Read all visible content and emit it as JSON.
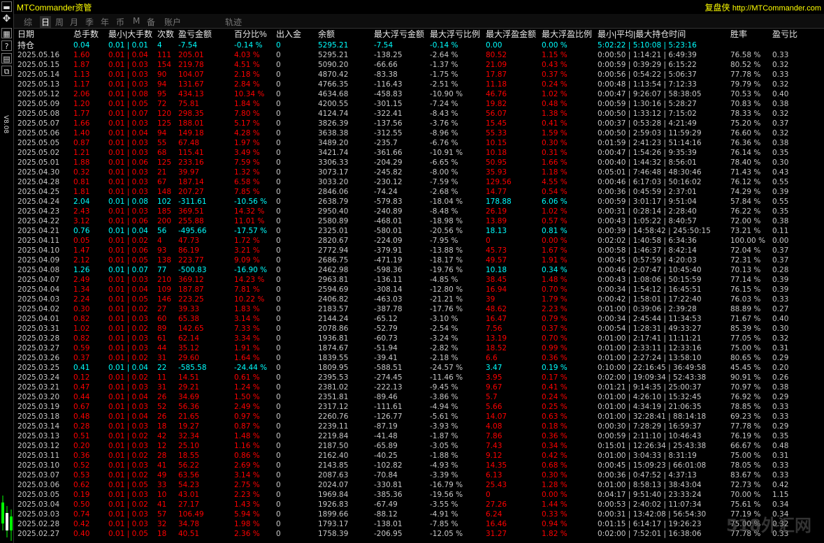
{
  "app": {
    "title": "MTCommander资管",
    "brand_cn": "复盘侠",
    "brand_url": "http://MTCommander.com"
  },
  "toolbar": {
    "version": "V8.08"
  },
  "tabs": [
    {
      "label": "综",
      "active": false
    },
    {
      "label": "日",
      "active": true
    },
    {
      "label": "周",
      "active": false
    },
    {
      "label": "月",
      "active": false
    },
    {
      "label": "季",
      "active": false
    },
    {
      "label": "年",
      "active": false
    },
    {
      "label": "币",
      "active": false
    },
    {
      "label": "M",
      "active": false
    },
    {
      "label": "备",
      "active": false
    },
    {
      "label": "账户",
      "active": false
    },
    {
      "label": "轨迹",
      "active": false
    }
  ],
  "columns": [
    "日期",
    "总手数",
    "最小|大手数",
    "次数",
    "盈亏金额",
    "百分比%",
    "出入金",
    "余额",
    "最大浮亏金额",
    "最大浮亏比例",
    "最大浮盈金额",
    "最大浮盈比例",
    "最小|平均|最大持仓时间",
    "胜率",
    "盈亏比"
  ],
  "holding": [
    "持仓",
    "0.04",
    "0.01 | 0.01",
    "4",
    "-7.54",
    "-0.14 %",
    "0",
    "5295.21",
    "-7.54",
    "-0.14 %",
    "0.00",
    "0.00 %",
    "5:02:22 | 5:10:08 | 5:23:16",
    "",
    ""
  ],
  "rows": [
    {
      "c": [
        "2025.05.16",
        "1.60",
        "0.01 | 0.04",
        "111",
        "205.01",
        "4.03 %",
        "0",
        "5295.21",
        "-138.25",
        "-2.64 %",
        "80.52",
        "1.15 %",
        "0:00:50 | 1:14:21 | 6:49:39",
        "76.58 %",
        "0.33"
      ],
      "p": true
    },
    {
      "c": [
        "2025.05.15",
        "1.87",
        "0.01 | 0.03",
        "154",
        "219.78",
        "4.51 %",
        "0",
        "5090.20",
        "-66.66",
        "-1.37 %",
        "21.09",
        "0.43 %",
        "0:00:59 | 0:39:29 | 6:15:22",
        "80.52 %",
        "0.32"
      ],
      "p": true
    },
    {
      "c": [
        "2025.05.14",
        "1.13",
        "0.01 | 0.03",
        "90",
        "104.07",
        "2.18 %",
        "0",
        "4870.42",
        "-83.38",
        "-1.75 %",
        "17.87",
        "0.37 %",
        "0:00:56 | 0:54:22 | 5:06:37",
        "77.78 %",
        "0.33"
      ],
      "p": true
    },
    {
      "c": [
        "2025.05.13",
        "1.17",
        "0.01 | 0.03",
        "94",
        "131.67",
        "2.84 %",
        "0",
        "4766.35",
        "-116.43",
        "-2.51 %",
        "11.18",
        "0.24 %",
        "0:00:48 | 1:13:54 | 7:12:33",
        "79.79 %",
        "0.32"
      ],
      "p": true
    },
    {
      "c": [
        "2025.05.12",
        "2.06",
        "0.01 | 0.08",
        "95",
        "434.13",
        "10.34 %",
        "0",
        "4634.68",
        "-458.83",
        "-10.90 %",
        "46.76",
        "1.02 %",
        "0:00:47 | 9:26:07 | 58:38:05",
        "70.53 %",
        "0.40"
      ],
      "p": true
    },
    {
      "c": [
        "2025.05.09",
        "1.20",
        "0.01 | 0.05",
        "72",
        "75.81",
        "1.84 %",
        "0",
        "4200.55",
        "-301.15",
        "-7.24 %",
        "19.82",
        "0.48 %",
        "0:00:59 | 1:30:16 | 5:28:27",
        "70.83 %",
        "0.38"
      ],
      "p": true
    },
    {
      "c": [
        "2025.05.08",
        "1.77",
        "0.01 | 0.07",
        "120",
        "298.35",
        "7.80 %",
        "0",
        "4124.74",
        "-322.41",
        "-8.43 %",
        "56.07",
        "1.38 %",
        "0:00:50 | 1:33:12 | 7:15:02",
        "78.33 %",
        "0.32"
      ],
      "p": true
    },
    {
      "c": [
        "2025.05.07",
        "1.66",
        "0.01 | 0.03",
        "125",
        "188.01",
        "5.17 %",
        "0",
        "3826.39",
        "-137.56",
        "-3.76 %",
        "15.45",
        "0.41 %",
        "0:00:37 | 0:53:28 | 4:21:49",
        "75.20 %",
        "0.37"
      ],
      "p": true
    },
    {
      "c": [
        "2025.05.06",
        "1.40",
        "0.01 | 0.04",
        "94",
        "149.18",
        "4.28 %",
        "0",
        "3638.38",
        "-312.55",
        "-8.96 %",
        "55.33",
        "1.59 %",
        "0:00:50 | 2:59:03 | 11:59:29",
        "76.60 %",
        "0.32"
      ],
      "p": true
    },
    {
      "c": [
        "2025.05.05",
        "0.87",
        "0.01 | 0.03",
        "55",
        "67.48",
        "1.97 %",
        "0",
        "3489.20",
        "-235.7",
        "-6.76 %",
        "10.15",
        "0.30 %",
        "0:01:59 | 2:41:23 | 51:14:16",
        "76.36 %",
        "0.38"
      ],
      "p": true
    },
    {
      "c": [
        "2025.05.02",
        "1.21",
        "0.01 | 0.03",
        "68",
        "115.41",
        "3.49 %",
        "0",
        "3421.74",
        "-361.66",
        "-10.91 %",
        "10.18",
        "0.31 %",
        "0:00:47 | 1:54:26 | 9:35:39",
        "76.14 %",
        "0.35"
      ],
      "p": true
    },
    {
      "c": [
        "2025.05.01",
        "1.88",
        "0.01 | 0.06",
        "125",
        "233.16",
        "7.59 %",
        "0",
        "3306.33",
        "-204.29",
        "-6.65 %",
        "50.95",
        "1.66 %",
        "0:00:40 | 1:44:32 | 8:56:01",
        "78.40 %",
        "0.30"
      ],
      "p": true
    },
    {
      "c": [
        "2025.04.30",
        "0.32",
        "0.01 | 0.03",
        "21",
        "39.97",
        "1.32 %",
        "0",
        "3073.17",
        "-245.82",
        "-8.00 %",
        "35.93",
        "1.18 %",
        "0:05:01 | 7:46:48 | 48:30:46",
        "71.43 %",
        "0.43"
      ],
      "p": true
    },
    {
      "c": [
        "2025.04.28",
        "0.81",
        "0.01 | 0.03",
        "67",
        "187.14",
        "6.58 %",
        "0",
        "3033.20",
        "-230.12",
        "-7.59 %",
        "129.56",
        "4.55 %",
        "0:00:46 | 6:17:03 | 50:16:02",
        "76.12 %",
        "0.55"
      ],
      "p": true
    },
    {
      "c": [
        "2025.04.25",
        "1.81",
        "0.01 | 0.03",
        "148",
        "207.27",
        "7.85 %",
        "0",
        "2846.06",
        "-74.24",
        "-2.68 %",
        "14.77",
        "0.54 %",
        "0:00:36 | 0:45:59 | 2:37:01",
        "74.29 %",
        "0.39"
      ],
      "p": true
    },
    {
      "c": [
        "2025.04.24",
        "2.04",
        "0.01 | 0.08",
        "102",
        "-311.61",
        "-10.56 %",
        "0",
        "2638.79",
        "-579.83",
        "-18.04 %",
        "178.88",
        "6.06 %",
        "0:00:59 | 3:01:17 | 9:51:04",
        "57.84 %",
        "0.55"
      ],
      "p": false
    },
    {
      "c": [
        "2025.04.23",
        "2.43",
        "0.01 | 0.03",
        "185",
        "369.51",
        "14.32 %",
        "0",
        "2950.40",
        "-240.89",
        "-8.48 %",
        "26.19",
        "1.02 %",
        "0:00:31 | 0:28:14 | 2:28:40",
        "76.22 %",
        "0.35"
      ],
      "p": true
    },
    {
      "c": [
        "2025.04.22",
        "3.12",
        "0.01 | 0.06",
        "200",
        "255.88",
        "11.01 %",
        "0",
        "2580.89",
        "-468.01",
        "-18.98 %",
        "13.89",
        "0.57 %",
        "0:00:43 | 1:05:22 | 8:40:57",
        "72.00 %",
        "0.38"
      ],
      "p": true
    },
    {
      "c": [
        "2025.04.21",
        "0.76",
        "0.01 | 0.04",
        "56",
        "-495.66",
        "-17.57 %",
        "0",
        "2325.01",
        "-580.01",
        "-20.56 %",
        "18.13",
        "0.81 %",
        "0:00:39 | 14:58:42 | 245:50:15",
        "73.21 %",
        "0.11"
      ],
      "p": false
    },
    {
      "c": [
        "2025.04.11",
        "0.05",
        "0.01 | 0.02",
        "4",
        "47.73",
        "1.72 %",
        "0",
        "2820.67",
        "-224.09",
        "-7.95 %",
        "0",
        "0.00 %",
        "0:02:02 | 1:40:58 | 6:34:36",
        "100.00 %",
        "0.00"
      ],
      "p": true
    },
    {
      "c": [
        "2025.04.10",
        "1.47",
        "0.01 | 0.06",
        "93",
        "86.19",
        "3.21 %",
        "0",
        "2772.94",
        "-379.91",
        "-13.88 %",
        "45.73",
        "1.67 %",
        "0:00:58 | 1:46:37 | 8:42:14",
        "72.04 %",
        "0.37"
      ],
      "p": true
    },
    {
      "c": [
        "2025.04.09",
        "2.12",
        "0.01 | 0.05",
        "138",
        "223.77",
        "9.09 %",
        "0",
        "2686.75",
        "-471.19",
        "-18.17 %",
        "49.57",
        "1.91 %",
        "0:00:45 | 0:57:59 | 4:20:03",
        "72.31 %",
        "0.37"
      ],
      "p": true
    },
    {
      "c": [
        "2025.04.08",
        "1.26",
        "0.01 | 0.07",
        "77",
        "-500.83",
        "-16.90 %",
        "0",
        "2462.98",
        "-598.36",
        "-19.76 %",
        "10.18",
        "0.34 %",
        "0:00:46 | 2:07:47 | 10:45:40",
        "70.13 %",
        "0.28"
      ],
      "p": false
    },
    {
      "c": [
        "2025.04.07",
        "2.49",
        "0.01 | 0.03",
        "210",
        "369.12",
        "14.23 %",
        "0",
        "2963.81",
        "-136.11",
        "-4.85 %",
        "38.45",
        "1.48 %",
        "0:00:43 | 1:08:06 | 50:15:59",
        "77.14 %",
        "0.39"
      ],
      "p": true
    },
    {
      "c": [
        "2025.04.04",
        "1.34",
        "0.01 | 0.04",
        "109",
        "187.87",
        "7.81 %",
        "0",
        "2594.69",
        "-308.14",
        "-12.80 %",
        "16.94",
        "0.70 %",
        "0:00:34 | 1:54:12 | 16:45:51",
        "76.15 %",
        "0.39"
      ],
      "p": true
    },
    {
      "c": [
        "2025.04.03",
        "2.24",
        "0.01 | 0.05",
        "146",
        "223.25",
        "10.22 %",
        "0",
        "2406.82",
        "-463.03",
        "-21.21 %",
        "39",
        "1.79 %",
        "0:00:42 | 1:58:01 | 17:22:40",
        "76.03 %",
        "0.33"
      ],
      "p": true
    },
    {
      "c": [
        "2025.04.02",
        "0.30",
        "0.01 | 0.02",
        "27",
        "39.33",
        "1.83 %",
        "0",
        "2183.57",
        "-387.78",
        "-17.76 %",
        "48.62",
        "2.23 %",
        "0:01:00 | 0:39:06 | 2:39:28",
        "88.89 %",
        "0.27"
      ],
      "p": true
    },
    {
      "c": [
        "2025.04.01",
        "0.82",
        "0.01 | 0.03",
        "60",
        "65.38",
        "3.14 %",
        "0",
        "2144.24",
        "-65.12",
        "-3.10 %",
        "16.47",
        "0.79 %",
        "0:00:34 | 2:45:44 | 11:34:53",
        "71.67 %",
        "0.40"
      ],
      "p": true
    },
    {
      "c": [
        "2025.03.31",
        "1.02",
        "0.01 | 0.02",
        "89",
        "142.65",
        "7.33 %",
        "0",
        "2078.86",
        "-52.79",
        "-2.54 %",
        "7.56",
        "0.37 %",
        "0:00:54 | 1:28:31 | 49:33:27",
        "85.39 %",
        "0.30"
      ],
      "p": true
    },
    {
      "c": [
        "2025.03.28",
        "0.82",
        "0.01 | 0.03",
        "61",
        "62.14",
        "3.34 %",
        "0",
        "1936.81",
        "-60.73",
        "-3.24 %",
        "13.19",
        "0.70 %",
        "0:01:00 | 2:17:41 | 11:11:21",
        "77.05 %",
        "0.32"
      ],
      "p": true
    },
    {
      "c": [
        "2025.03.27",
        "0.59",
        "0.01 | 0.03",
        "44",
        "35.12",
        "1.91 %",
        "0",
        "1874.67",
        "-51.94",
        "-2.82 %",
        "18.52",
        "0.99 %",
        "0:01:00 | 2:33:11 | 12:33:16",
        "75.00 %",
        "0.31"
      ],
      "p": true
    },
    {
      "c": [
        "2025.03.26",
        "0.37",
        "0.01 | 0.02",
        "31",
        "29.60",
        "1.64 %",
        "0",
        "1839.55",
        "-39.41",
        "-2.18 %",
        "6.6",
        "0.36 %",
        "0:01:00 | 2:27:24 | 13:58:10",
        "80.65 %",
        "0.29"
      ],
      "p": true
    },
    {
      "c": [
        "2025.03.25",
        "0.41",
        "0.01 | 0.04",
        "22",
        "-585.58",
        "-24.44 %",
        "0",
        "1809.95",
        "-588.51",
        "-24.57 %",
        "3.47",
        "0.19 %",
        "0:10:00 | 22:16:45 | 36:49:58",
        "45.45 %",
        "0.20"
      ],
      "p": false
    },
    {
      "c": [
        "2025.03.24",
        "0.12",
        "0.01 | 0.02",
        "11",
        "14.51",
        "0.61 %",
        "0",
        "2395.53",
        "-274.45",
        "-11.46 %",
        "3.95",
        "0.17 %",
        "0:02:00 | 19:09:34 | 52:43:38",
        "90.91 %",
        "0.26"
      ],
      "p": true
    },
    {
      "c": [
        "2025.03.21",
        "0.47",
        "0.01 | 0.03",
        "31",
        "29.21",
        "1.24 %",
        "0",
        "2381.02",
        "-222.13",
        "-9.45 %",
        "9.67",
        "0.41 %",
        "0:01:21 | 9:14:35 | 25:00:37",
        "70.97 %",
        "0.38"
      ],
      "p": true
    },
    {
      "c": [
        "2025.03.20",
        "0.44",
        "0.01 | 0.04",
        "26",
        "34.69",
        "1.50 %",
        "0",
        "2351.81",
        "-89.46",
        "-3.86 %",
        "5.7",
        "0.24 %",
        "0:01:00 | 4:26:10 | 15:32:45",
        "76.92 %",
        "0.29"
      ],
      "p": true
    },
    {
      "c": [
        "2025.03.19",
        "0.67",
        "0.01 | 0.03",
        "52",
        "56.36",
        "2.49 %",
        "0",
        "2317.12",
        "-111.61",
        "-4.94 %",
        "5.66",
        "0.25 %",
        "0:01:00 | 4:34:19 | 21:06:35",
        "78.85 %",
        "0.33"
      ],
      "p": true
    },
    {
      "c": [
        "2025.03.18",
        "0.48",
        "0.01 | 0.04",
        "26",
        "21.65",
        "0.97 %",
        "0",
        "2260.76",
        "-126.77",
        "-5.61 %",
        "14.07",
        "0.63 %",
        "0:01:00 | 32:28:41 | 88:14:18",
        "69.23 %",
        "0.33"
      ],
      "p": true
    },
    {
      "c": [
        "2025.03.14",
        "0.28",
        "0.01 | 0.03",
        "18",
        "19.27",
        "0.87 %",
        "0",
        "2239.11",
        "-87.19",
        "-3.93 %",
        "4.08",
        "0.18 %",
        "0:00:30 | 7:28:29 | 16:59:37",
        "77.78 %",
        "0.29"
      ],
      "p": true
    },
    {
      "c": [
        "2025.03.13",
        "0.51",
        "0.01 | 0.02",
        "42",
        "32.34",
        "1.48 %",
        "0",
        "2219.84",
        "-41.48",
        "-1.87 %",
        "7.86",
        "0.36 %",
        "0:00:59 | 2:11:10 | 10:46:43",
        "76.19 %",
        "0.35"
      ],
      "p": true
    },
    {
      "c": [
        "2025.03.12",
        "0.20",
        "0.01 | 0.03",
        "12",
        "25.10",
        "1.16 %",
        "0",
        "2187.50",
        "-65.89",
        "-3.05 %",
        "7.43",
        "0.34 %",
        "0:15:01 | 12:26:34 | 25:43:38",
        "66.67 %",
        "0.48"
      ],
      "p": true
    },
    {
      "c": [
        "2025.03.11",
        "0.36",
        "0.01 | 0.02",
        "28",
        "18.55",
        "0.86 %",
        "0",
        "2162.40",
        "-40.25",
        "-1.88 %",
        "9.12",
        "0.42 %",
        "0:01:00 | 3:04:33 | 8:31:19",
        "75.00 %",
        "0.31"
      ],
      "p": true
    },
    {
      "c": [
        "2025.03.10",
        "0.52",
        "0.01 | 0.03",
        "41",
        "56.22",
        "2.69 %",
        "0",
        "2143.85",
        "-102.82",
        "-4.93 %",
        "14.35",
        "0.68 %",
        "0:00:45 | 15:09:23 | 66:01:08",
        "78.05 %",
        "0.33"
      ],
      "p": true
    },
    {
      "c": [
        "2025.03.07",
        "0.53",
        "0.01 | 0.02",
        "49",
        "63.56",
        "3.14 %",
        "0",
        "2087.63",
        "-70.84",
        "-3.39 %",
        "6.13",
        "0.30 %",
        "0:00:36 | 0:47:52 | 4:37:13",
        "83.67 %",
        "0.33"
      ],
      "p": true
    },
    {
      "c": [
        "2025.03.06",
        "0.62",
        "0.01 | 0.05",
        "33",
        "54.23",
        "2.75 %",
        "0",
        "2024.07",
        "-330.81",
        "-16.79 %",
        "25.43",
        "1.28 %",
        "0:01:00 | 8:58:13 | 38:43:04",
        "72.73 %",
        "0.42"
      ],
      "p": true
    },
    {
      "c": [
        "2025.03.05",
        "0.19",
        "0.01 | 0.03",
        "10",
        "43.01",
        "2.23 %",
        "0",
        "1969.84",
        "-385.36",
        "-19.56 %",
        "0",
        "0.00 %",
        "0:04:17 | 9:51:40 | 23:33:24",
        "70.00 %",
        "1.15"
      ],
      "p": true
    },
    {
      "c": [
        "2025.03.04",
        "0.50",
        "0.01 | 0.02",
        "41",
        "27.17",
        "1.43 %",
        "0",
        "1926.83",
        "-67.49",
        "-3.55 %",
        "27.26",
        "1.44 %",
        "0:00:53 | 2:40:02 | 11:07:34",
        "75.61 %",
        "0.34"
      ],
      "p": true
    },
    {
      "c": [
        "2025.03.03",
        "0.74",
        "0.01 | 0.03",
        "57",
        "106.49",
        "5.94 %",
        "0",
        "1899.66",
        "-88.12",
        "-4.91 %",
        "6.24",
        "0.33 %",
        "0:00:31 | 13:42:08 | 56:54:30",
        "77.19 %",
        "0.34"
      ],
      "p": true
    },
    {
      "c": [
        "2025.02.28",
        "0.42",
        "0.01 | 0.03",
        "32",
        "34.78",
        "1.98 %",
        "0",
        "1793.17",
        "-138.01",
        "-7.85 %",
        "16.46",
        "0.94 %",
        "0:01:15 | 6:14:17 | 19:26:23",
        "75.00 %",
        "0.32"
      ],
      "p": true
    },
    {
      "c": [
        "2025.02.27",
        "0.40",
        "0.01 | 0.05",
        "18",
        "40.51",
        "2.36 %",
        "0",
        "1758.39",
        "-206.95",
        "-12.05 %",
        "31.27",
        "1.82 %",
        "0:02:00 | 7:52:01 | 16:38:06",
        "77.78 %",
        "0.33"
      ],
      "p": true
    }
  ],
  "colors": {
    "positive": "#ff0000",
    "negative": "#00ffff",
    "header": "#e6e6e6",
    "title": "#ffff00"
  },
  "watermark": "518外汇网"
}
